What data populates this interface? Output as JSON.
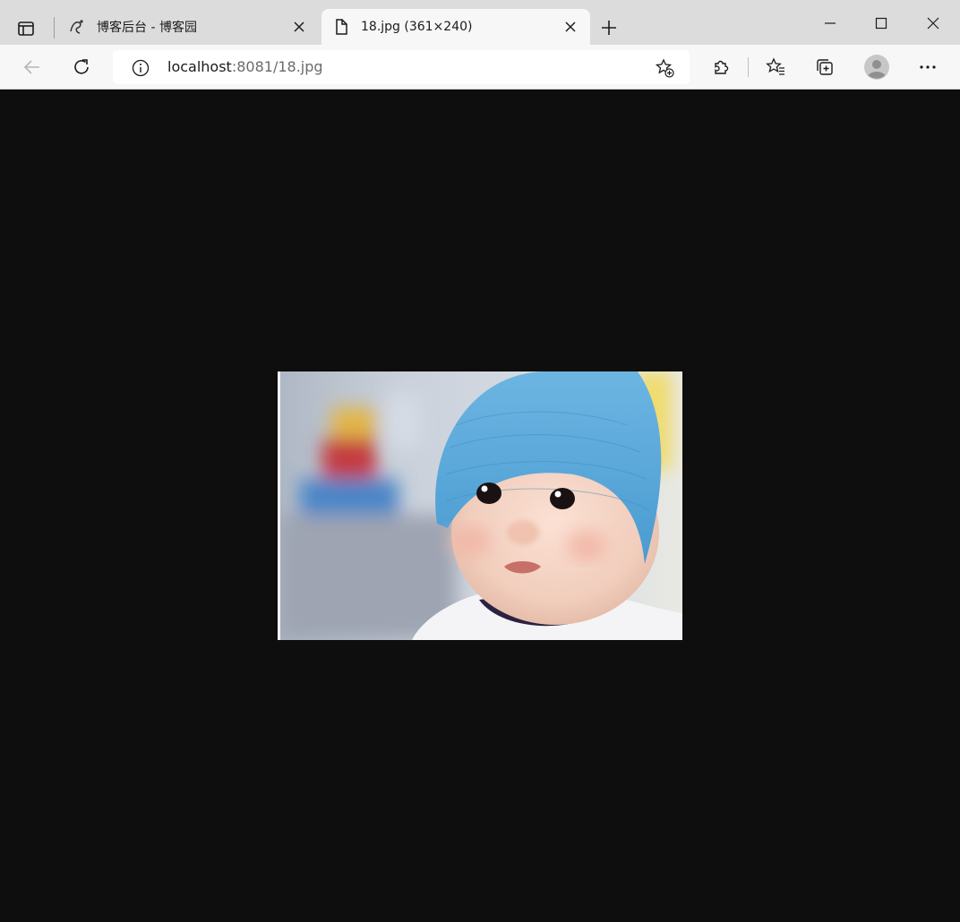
{
  "browser": {
    "tabs": [
      {
        "title": "博客后台 - 博客园",
        "favicon": "cnblogs-icon",
        "active": false
      },
      {
        "title": "18.jpg (361×240)",
        "favicon": "document-icon",
        "active": true
      }
    ],
    "address": {
      "host": "localhost",
      "rest": ":8081/18.jpg"
    }
  },
  "image": {
    "description_icon": "photo-baby-blue-hat",
    "colors": {
      "hat": "#5aa7d8",
      "background": "#0e0e0e"
    }
  }
}
